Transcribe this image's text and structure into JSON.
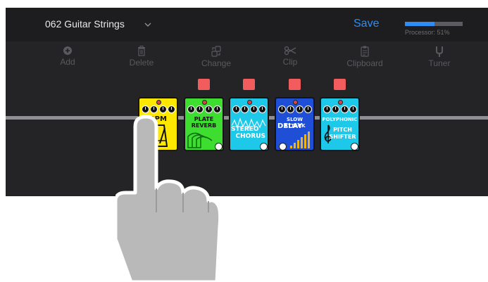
{
  "header": {
    "preset_name": "062 Guitar Strings",
    "save_label": "Save",
    "processor_label": "Processor: 51%",
    "processor_level": 0.51
  },
  "toolbar": [
    {
      "label": "Add",
      "icon": "add-circle-icon"
    },
    {
      "label": "Delete",
      "icon": "trash-icon"
    },
    {
      "label": "Change",
      "icon": "change-icon"
    },
    {
      "label": "Clip",
      "icon": "scissors-icon"
    },
    {
      "label": "Clipboard",
      "icon": "clipboard-icon"
    },
    {
      "label": "Tuner",
      "icon": "tuning-fork-icon"
    }
  ],
  "pedals": [
    {
      "name": "BPM",
      "lines": [
        "BPM"
      ],
      "color": "#ffe800",
      "has_toggle": false
    },
    {
      "name": "Plate Reverb",
      "lines": [
        "PLATE",
        "REVERB"
      ],
      "color": "#3dde2f",
      "has_toggle": true
    },
    {
      "name": "Stereo Chorus",
      "lines": [
        "STEREO",
        "CHORUS"
      ],
      "color": "#1ec8e8",
      "has_toggle": true
    },
    {
      "name": "Slow Attack Delay",
      "lines": [
        "SLOW ATTACK",
        "DELAY"
      ],
      "color": "#1f4fd6",
      "has_toggle": true
    },
    {
      "name": "Polyphonic Pitch Shifter",
      "lines": [
        "POLYPHONIC",
        "PITCH",
        "SHIFTER"
      ],
      "color": "#1ec8e8",
      "has_toggle": true
    }
  ],
  "colors": {
    "accent": "#2e8cf2",
    "toggle_on": "#f25c5c",
    "background": "#1f1f21"
  }
}
